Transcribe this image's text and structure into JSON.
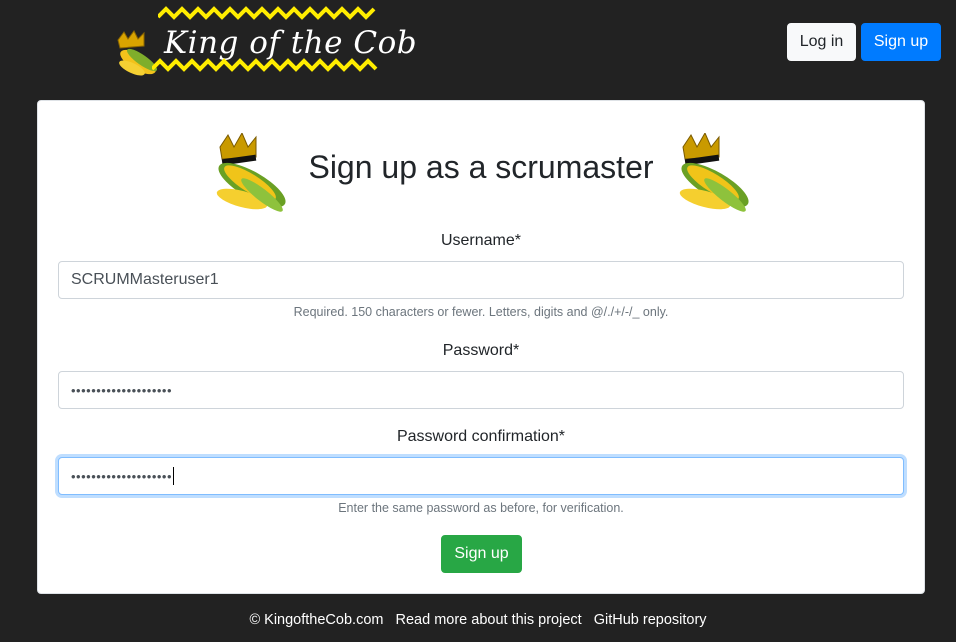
{
  "header": {
    "logo_text": "King of the Cob",
    "login_label": "Log in",
    "signup_label": "Sign up"
  },
  "form": {
    "title": "Sign up as a scrumaster",
    "username": {
      "label": "Username",
      "required_mark": "*",
      "value": "SCRUMMasteruser1",
      "help": "Required. 150 characters or fewer. Letters, digits and @/./+/-/_ only."
    },
    "password": {
      "label": "Password",
      "required_mark": "*",
      "masked_value": "••••••••••••••••••••"
    },
    "password_confirmation": {
      "label": "Password confirmation",
      "required_mark": "*",
      "masked_value": "••••••••••••••••••••",
      "help": "Enter the same password as before, for verification."
    },
    "submit_label": "Sign up"
  },
  "footer": {
    "copyright": "© KingoftheCob.com",
    "about_link": "Read more about this project",
    "github_link": "GitHub repository"
  },
  "colors": {
    "background": "#222222",
    "primary": "#007bff",
    "success": "#28a745",
    "logo_accent": "#ffed00"
  },
  "icons": [
    "corn-crown-logo-icon",
    "corn-king-mascot-icon"
  ]
}
